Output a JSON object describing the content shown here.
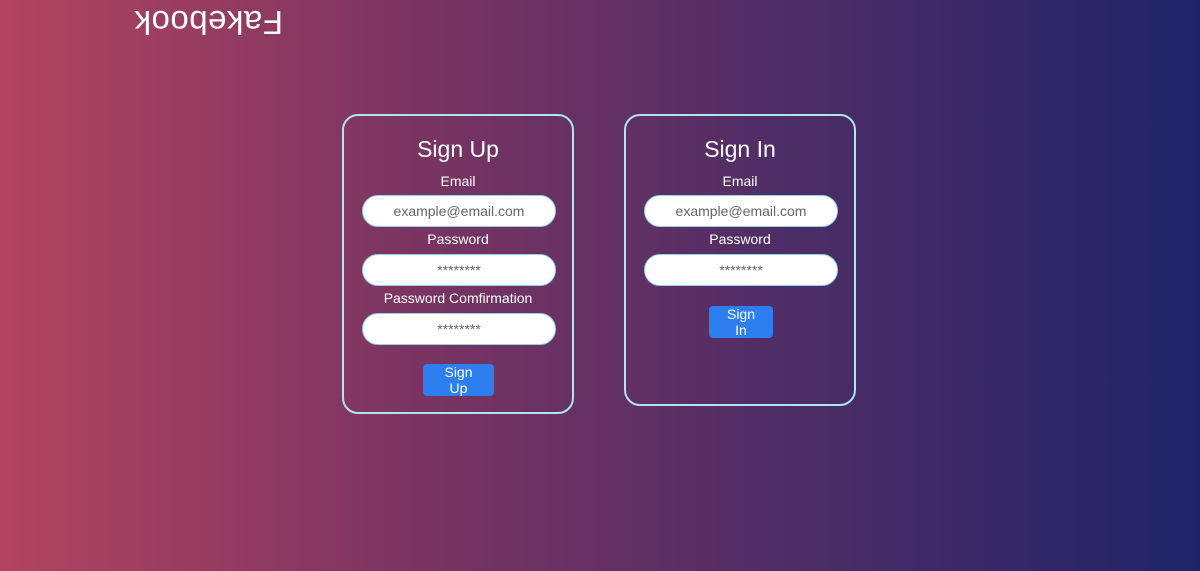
{
  "header": {
    "logo_text": "Fakebook"
  },
  "signup": {
    "title": "Sign Up",
    "email_label": "Email",
    "email_placeholder": "example@email.com",
    "password_label": "Password",
    "password_placeholder": "********",
    "confirm_label": "Password Comfirmation",
    "confirm_placeholder": "********",
    "submit_label": "Sign Up"
  },
  "signin": {
    "title": "Sign In",
    "email_label": "Email",
    "email_placeholder": "example@email.com",
    "password_label": "Password",
    "password_placeholder": "********",
    "submit_label": "Sign In"
  },
  "colors": {
    "background_left": "#b2445f",
    "background_right": "#1f2469",
    "card_border": "#aee6ee",
    "button": "#2d7ff0"
  }
}
